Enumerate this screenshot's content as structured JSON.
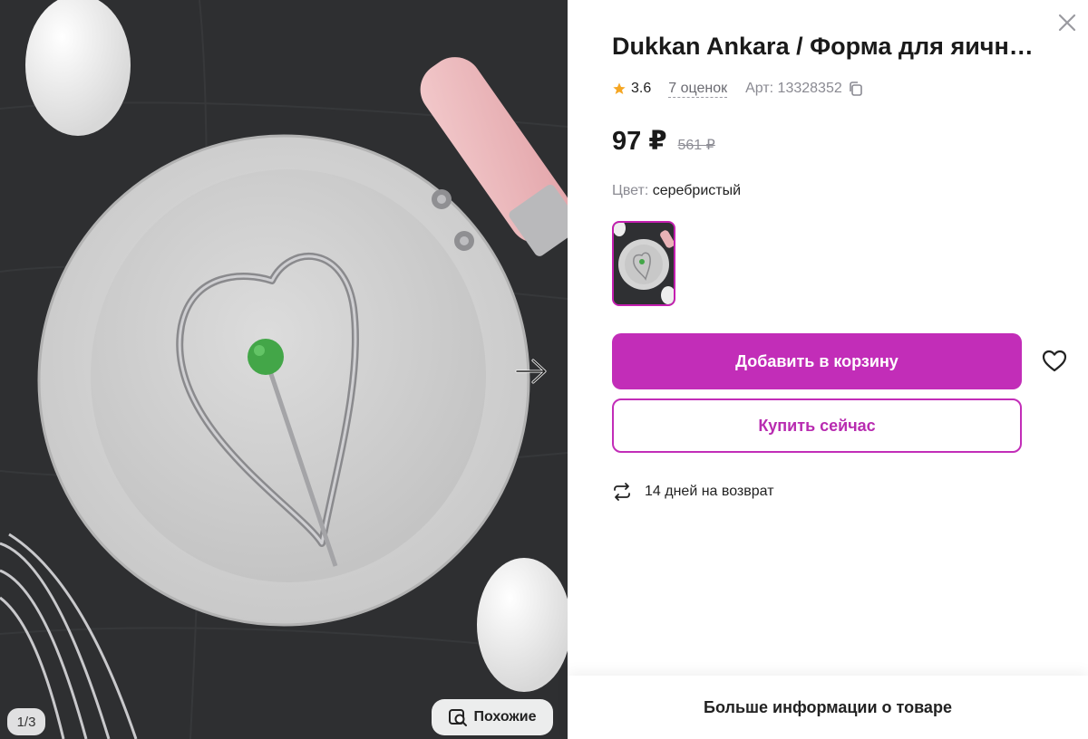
{
  "gallery": {
    "counter": "1/3",
    "similar_label": "Похожие",
    "icons": {
      "next": "arrow-right-icon",
      "similar": "image-search-icon"
    }
  },
  "product": {
    "title": "Dukkan Ankara / Форма для яичн…",
    "rating": "3.6",
    "reviews": "7 оценок",
    "article": "Арт: 13328352",
    "price": "97 ₽",
    "old_price": "561 ₽",
    "color_label": "Цвет:",
    "color_value": "серебристый"
  },
  "actions": {
    "add_to_cart": "Добавить в корзину",
    "buy_now": "Купить сейчас",
    "return_text": "14 дней на возврат",
    "more_info": "Больше информации о товаре"
  },
  "colors": {
    "accent": "#c22db8",
    "star": "#f5a623"
  },
  "icons": [
    "close-icon",
    "star-icon",
    "copy-icon",
    "heart-icon",
    "return-icon"
  ]
}
